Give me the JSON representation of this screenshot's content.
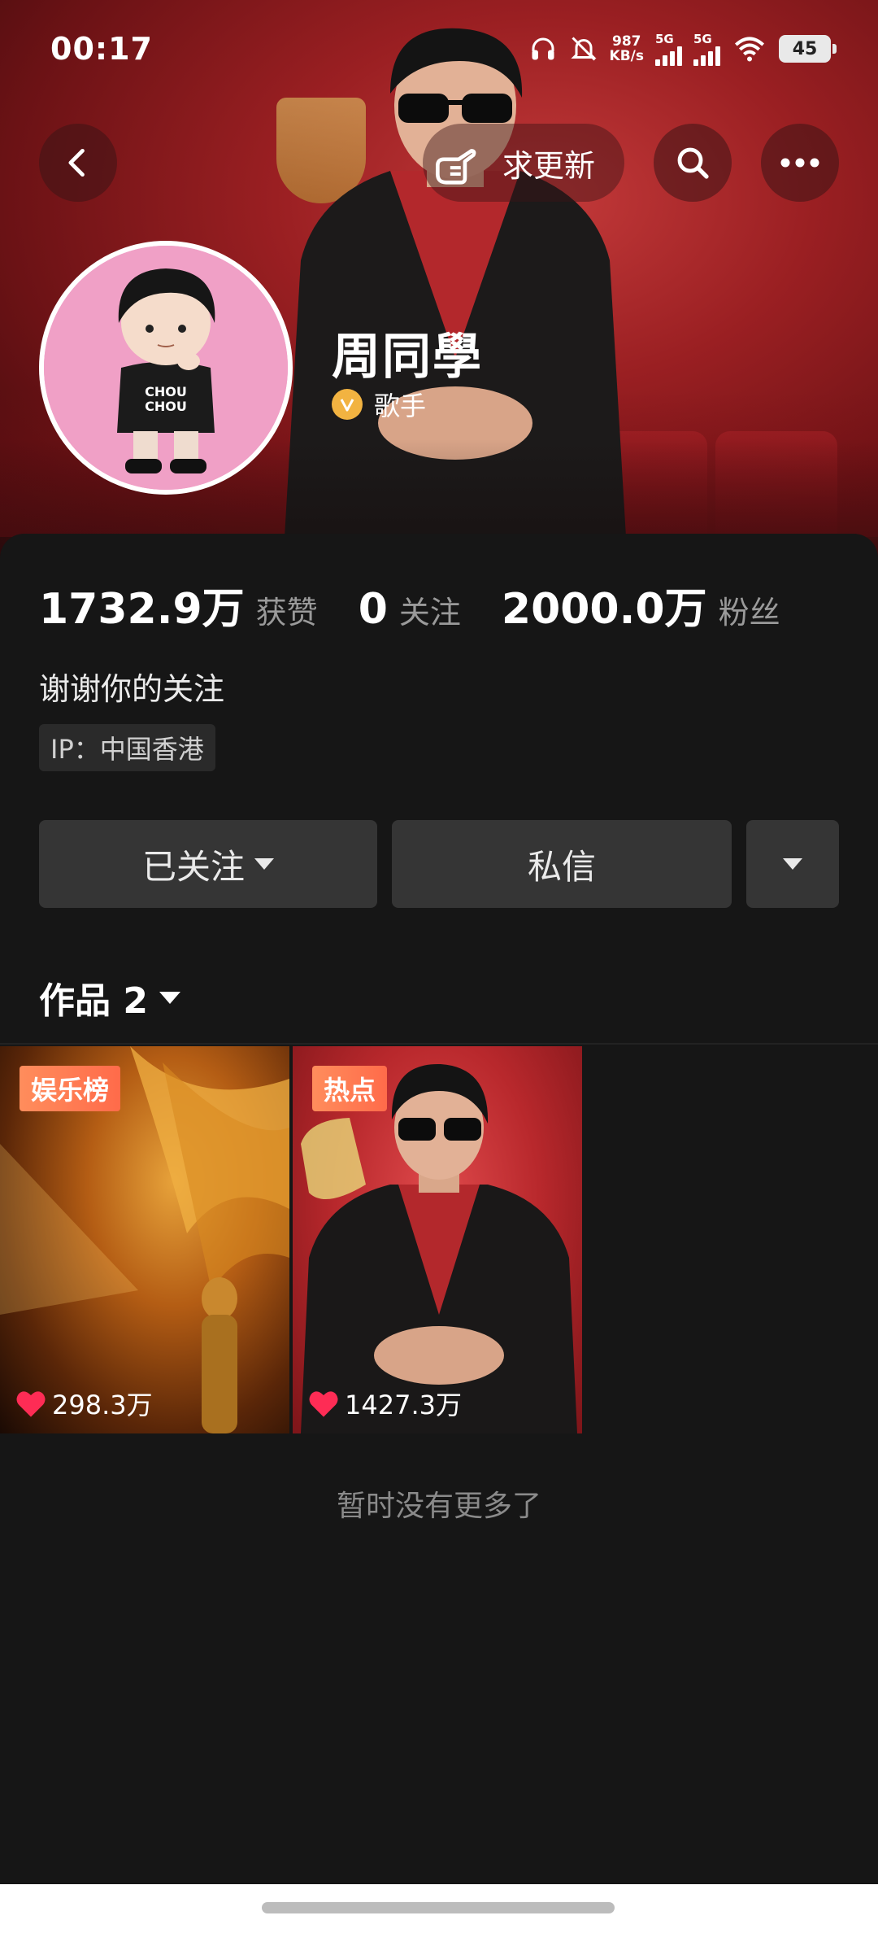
{
  "status_bar": {
    "time": "00:17",
    "net_speed_value": "987",
    "net_speed_unit": "KB/s",
    "sim1": "5G",
    "sim2": "5G",
    "battery": "45"
  },
  "header": {
    "update_label": "求更新",
    "colors": {
      "banner": "#9a1f22",
      "badge": "#f2b341"
    }
  },
  "profile": {
    "name": "周同學",
    "role": "歌手",
    "stats": [
      {
        "value": "1732.9万",
        "label": "获赞"
      },
      {
        "value": "0",
        "label": "关注"
      },
      {
        "value": "2000.0万",
        "label": "粉丝"
      }
    ],
    "bio": "谢谢你的关注",
    "ip": "IP：中国香港"
  },
  "actions": {
    "follow_label": "已关注",
    "message_label": "私信"
  },
  "works": {
    "title": "作品 2",
    "items": [
      {
        "tag": "娱乐榜",
        "likes": "298.3万"
      },
      {
        "tag": "热点",
        "likes": "1427.3万"
      }
    ],
    "end_text": "暂时没有更多了"
  }
}
